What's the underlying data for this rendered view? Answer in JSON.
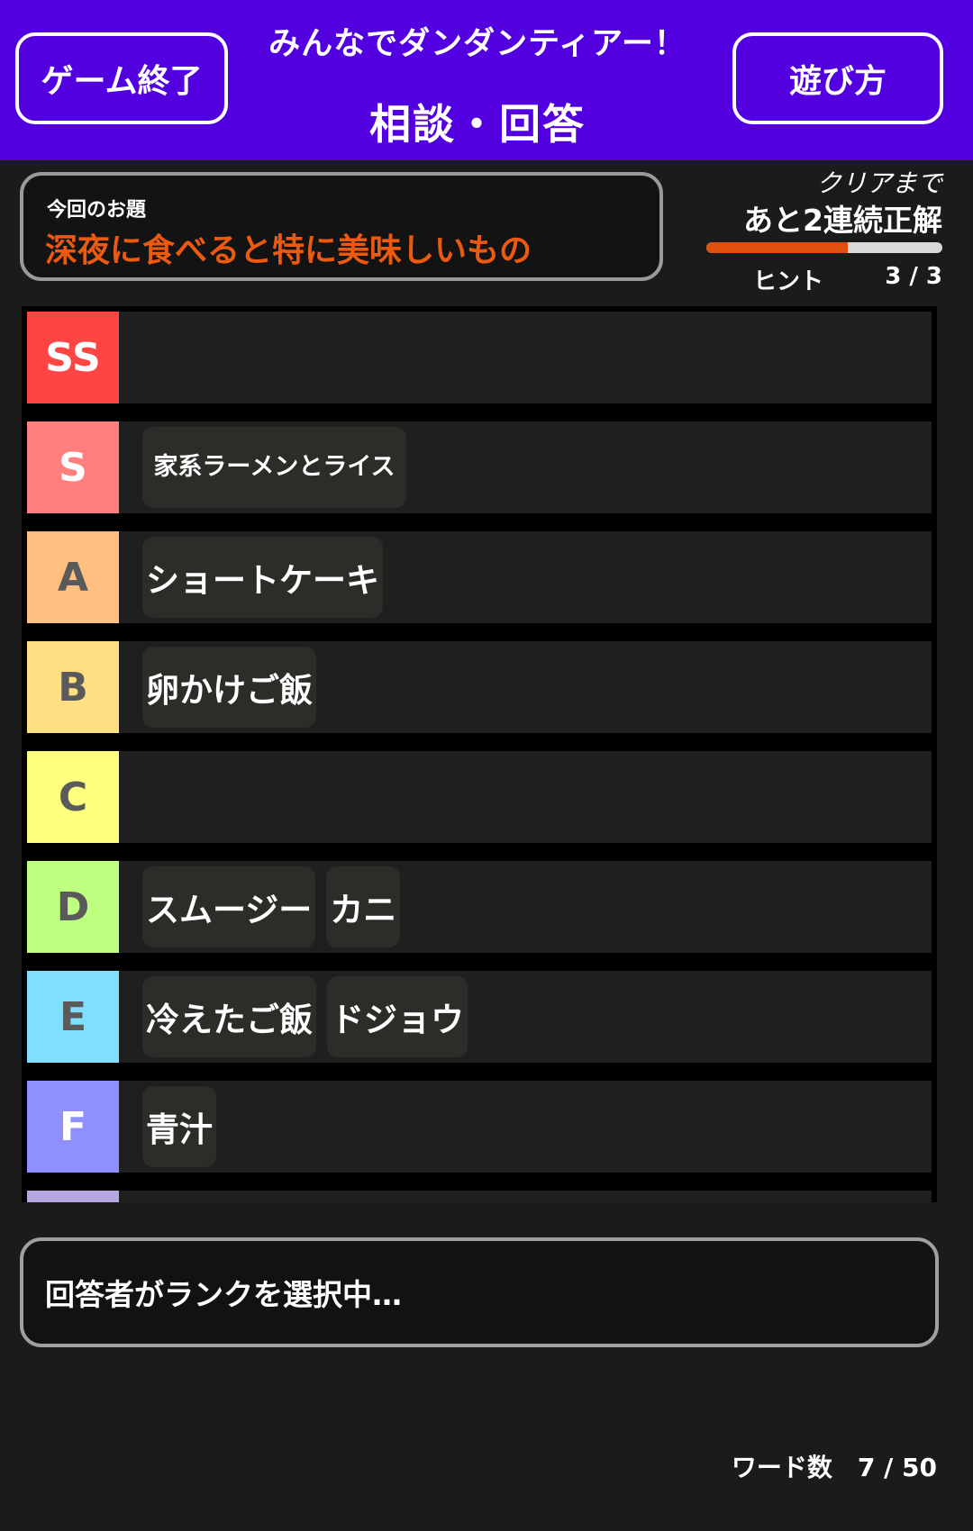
{
  "header": {
    "end_button": "ゲーム終了",
    "subtitle": "みんなでダンダンティアー！",
    "title": "相談・回答",
    "howto_button": "遊び方",
    "bg_color": "#5200e0"
  },
  "theme": {
    "label": "今回のお題",
    "text": "深夜に食べると特に美味しいもの",
    "text_color": "#ec5a10"
  },
  "progress": {
    "clear_label": "クリアまで",
    "remaining_text": "あと2連続正解",
    "progress_fraction": 0.6,
    "hint_label": "ヒント",
    "hint_count": "3 / 3"
  },
  "tiers": [
    {
      "label": "SS",
      "color": "#ff4444",
      "text_color": "#ffffff",
      "items": []
    },
    {
      "label": "S",
      "color": "#ff7f7f",
      "text_color": "#ffffff",
      "items": [
        "家系ラーメンとライス"
      ]
    },
    {
      "label": "A",
      "color": "#ffbf7f",
      "text_color": "#5a5a5a",
      "items": [
        "ショートケーキ"
      ]
    },
    {
      "label": "B",
      "color": "#ffdf7f",
      "text_color": "#5a5a5a",
      "items": [
        "卵かけご飯"
      ]
    },
    {
      "label": "C",
      "color": "#ffff7f",
      "text_color": "#5a5a5a",
      "items": []
    },
    {
      "label": "D",
      "color": "#bfff7f",
      "text_color": "#5a5a5a",
      "items": [
        "スムージー",
        "カニ"
      ]
    },
    {
      "label": "E",
      "color": "#7fdfff",
      "text_color": "#5a5a5a",
      "items": [
        "冷えたご飯",
        "ドジョウ"
      ]
    },
    {
      "label": "F",
      "color": "#8f8fff",
      "text_color": "#ffffff",
      "items": [
        "青汁"
      ]
    },
    {
      "label": "",
      "color": "#b7a6e0",
      "text_color": "#ffffff",
      "items": []
    }
  ],
  "status": {
    "text": "回答者がランクを選択中…"
  },
  "footer": {
    "word_count": "ワード数　7 / 50"
  }
}
